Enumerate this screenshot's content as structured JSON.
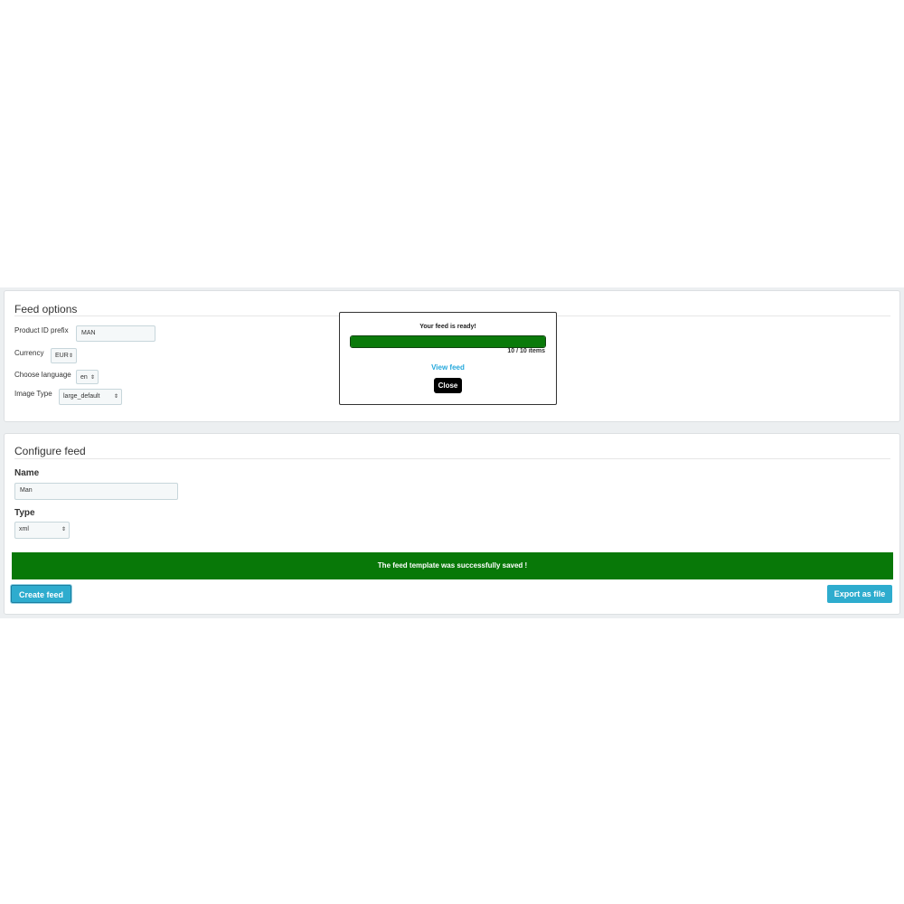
{
  "feed_options": {
    "title": "Feed options",
    "product_id_prefix": {
      "label": "Product ID prefix",
      "value": "MAN"
    },
    "currency": {
      "label": "Currency",
      "value": "EUR"
    },
    "language": {
      "label": "Choose language",
      "value": "en"
    },
    "image_type": {
      "label": "Image Type",
      "value": "large_default"
    }
  },
  "modal": {
    "title": "Your feed is ready!",
    "progress_text": "10 / 10 items",
    "progress_fraction": 1.0,
    "progress_color": "#0a7a0a",
    "view_link": "View feed",
    "close_label": "Close"
  },
  "configure_feed": {
    "title": "Configure feed",
    "name": {
      "label": "Name",
      "value": "Man"
    },
    "type": {
      "label": "Type",
      "value": "xml"
    },
    "success_message": "The feed template was successfully saved !",
    "success_color": "#087808",
    "create_label": "Create feed",
    "export_label": "Export as file",
    "button_color": "#2eacce"
  },
  "icons": {
    "select_arrow": "updown-arrows-icon"
  }
}
